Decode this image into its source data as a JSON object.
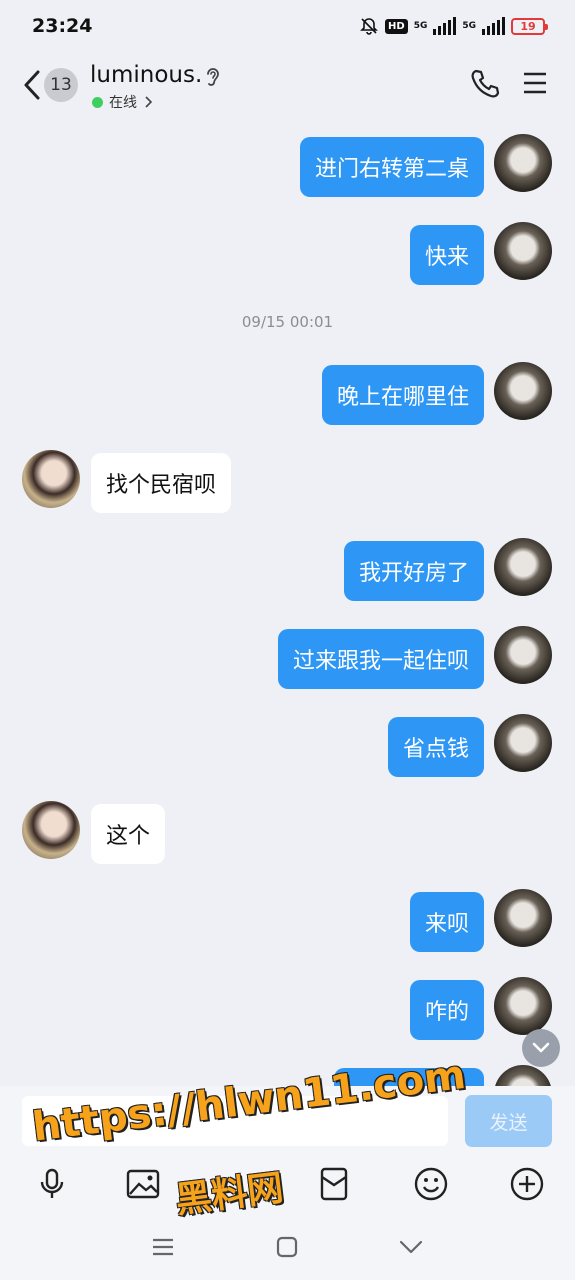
{
  "status_bar": {
    "time": "23:24",
    "hd": "HD",
    "net1": "5G",
    "net2": "5G",
    "battery": "19",
    "icons": [
      "bell-off-icon",
      "hd-icon",
      "signal-icon",
      "signal-icon",
      "battery-icon"
    ]
  },
  "header": {
    "unread_count": "13",
    "contact_name": "luminous.",
    "status": "在线",
    "icons": [
      "back-icon",
      "ear-icon",
      "phone-icon",
      "menu-icon"
    ]
  },
  "chat": {
    "timestamp": "09/15 00:01",
    "messages": [
      {
        "from": "me",
        "text": "进门右转第二桌"
      },
      {
        "from": "me",
        "text": "快来"
      },
      {
        "from": "me",
        "text": "晚上在哪里住"
      },
      {
        "from": "other",
        "text": "找个民宿呗"
      },
      {
        "from": "me",
        "text": "我开好房了"
      },
      {
        "from": "me",
        "text": "过来跟我一起住呗"
      },
      {
        "from": "me",
        "text": "省点钱"
      },
      {
        "from": "other",
        "text": "这个"
      },
      {
        "from": "me",
        "text": "来呗"
      },
      {
        "from": "me",
        "text": "咋的"
      },
      {
        "from": "me",
        "text": ""
      }
    ]
  },
  "input": {
    "value": "",
    "placeholder": "",
    "send_label": "发送"
  },
  "toolbar_icons": [
    "mic-icon",
    "image-icon",
    "red-packet-icon",
    "emoji-icon",
    "plus-icon"
  ],
  "watermark": {
    "url": "https://hlwn11.com",
    "name": "黑料网"
  },
  "colors": {
    "accent": "#2e97f6",
    "background": "#eef0f5",
    "send_disabled": "#9ccaf7",
    "online": "#3fcf5f",
    "watermark": "#f7a21b"
  }
}
